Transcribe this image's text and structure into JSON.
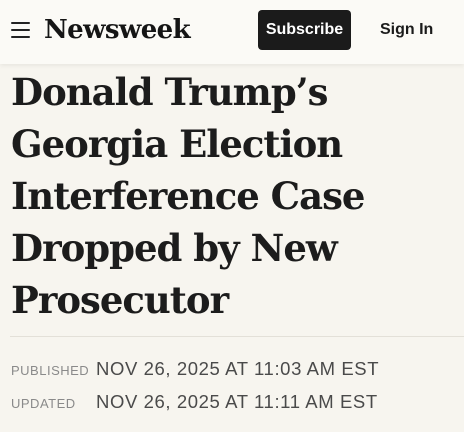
{
  "header": {
    "menu_icon": "hamburger-menu-icon",
    "logo_text": "Newsweek",
    "subscribe_label": "Subscribe",
    "signin_label": "Sign In"
  },
  "article": {
    "headline": "Donald Trump’s Georgia Election Interference Case Dropped by New Prosecutor",
    "published_label": "PUBLISHED",
    "published_value": "NOV 26, 2025 AT 11:03 AM EST",
    "updated_label": "UPDATED",
    "updated_value": "NOV 26, 2025 AT 11:11 AM EST"
  },
  "colors": {
    "background": "#f7f5ef",
    "subscribe_button": "#1b1b1b",
    "text": "#1c1c1c",
    "meta_label": "#8a8a8a"
  }
}
